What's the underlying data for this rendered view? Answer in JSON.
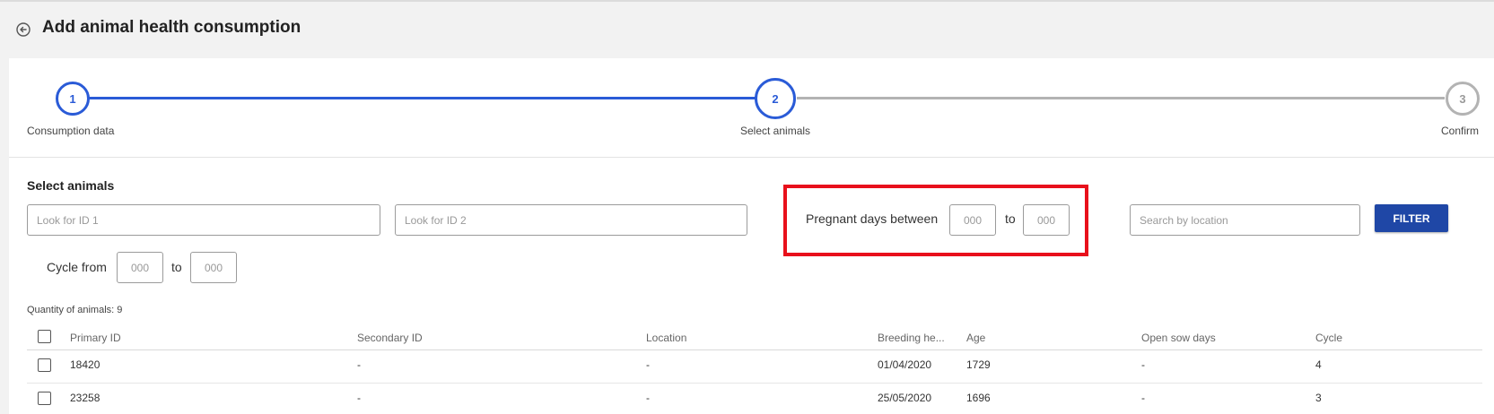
{
  "header": {
    "title": "Add animal health consumption",
    "back_icon": "back-arrow-icon"
  },
  "stepper": {
    "steps": [
      {
        "number": "1",
        "label": "Consumption data",
        "state": "completed"
      },
      {
        "number": "2",
        "label": "Select animals",
        "state": "active"
      },
      {
        "number": "3",
        "label": "Confirm",
        "state": "pending"
      }
    ],
    "active_color": "#2a5bd7",
    "inactive_color": "#b3b3b3"
  },
  "filters": {
    "section_title": "Select animals",
    "id1_placeholder": "Look for ID 1",
    "id2_placeholder": "Look for ID 2",
    "pregnant_label": "Pregnant days between",
    "pregnant_from_placeholder": "000",
    "pregnant_to_label": "to",
    "pregnant_to_placeholder": "000",
    "location_placeholder": "Search by location",
    "filter_button": "FILTER",
    "cycle_label": "Cycle from",
    "cycle_from_placeholder": "000",
    "cycle_to_label": "to",
    "cycle_to_placeholder": "000",
    "highlight_color": "#e8101b",
    "button_color": "#1f47a6"
  },
  "table": {
    "quantity_text": "Quantity of animals: 9",
    "columns": [
      "Primary ID",
      "Secondary ID",
      "Location",
      "Breeding he...",
      "Age",
      "Open sow days",
      "Cycle"
    ],
    "rows": [
      [
        "18420",
        "-",
        "-",
        "01/04/2020",
        "1729",
        "-",
        "4"
      ],
      [
        "23258",
        "-",
        "-",
        "25/05/2020",
        "1696",
        "-",
        "3"
      ]
    ]
  }
}
